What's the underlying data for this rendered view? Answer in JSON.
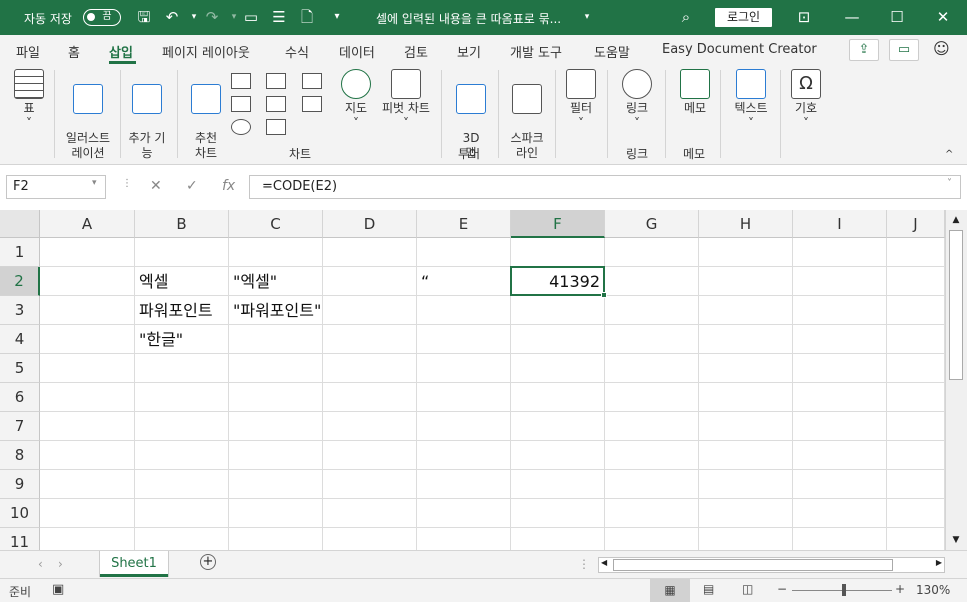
{
  "titlebar": {
    "autosave_label": "자동 저장",
    "autosave_state": "끔",
    "doc_title": "셀에 입력된 내용을 큰 따옴표로 묶...",
    "login": "로그인"
  },
  "menu": [
    "파일",
    "홈",
    "삽입",
    "페이지 레이아웃",
    "수식",
    "데이터",
    "검토",
    "보기",
    "개발 도구",
    "도움말",
    "Easy Document Creator"
  ],
  "ribbon": {
    "buttons": {
      "table": "표",
      "illustrations": "일러스트\n레이션",
      "addins": "추가 기\n능",
      "rec_charts": "추천\n차트",
      "maps": "지도",
      "pivot_chart": "피벗 차트",
      "map3d": "3D\n맵",
      "sparkline": "스파크\n라인",
      "filter": "필터",
      "link": "링크",
      "memo": "메모",
      "text": "텍스트",
      "symbol": "기호"
    },
    "groups": {
      "charts": "차트",
      "tours": "투어",
      "links": "링크",
      "comments": "메모"
    }
  },
  "formula": {
    "namebox": "F2",
    "formula": "=CODE(E2)"
  },
  "grid": {
    "columns": [
      "A",
      "B",
      "C",
      "D",
      "E",
      "F",
      "G",
      "H",
      "I",
      "J"
    ],
    "rows": [
      "1",
      "2",
      "3",
      "4",
      "5",
      "6",
      "7",
      "8",
      "9",
      "10",
      "11"
    ],
    "selected_column": "F",
    "selected_row": "2",
    "cells": {
      "B2": "엑셀",
      "C2": "\"엑셀\"",
      "E2": "“",
      "F2": "41392",
      "B3": "파워포인트",
      "C3": "\"파워포인트\"",
      "B4": "\"한글\""
    }
  },
  "sheets": {
    "active": "Sheet1"
  },
  "status": {
    "ready": "준비",
    "zoom": "130%"
  }
}
